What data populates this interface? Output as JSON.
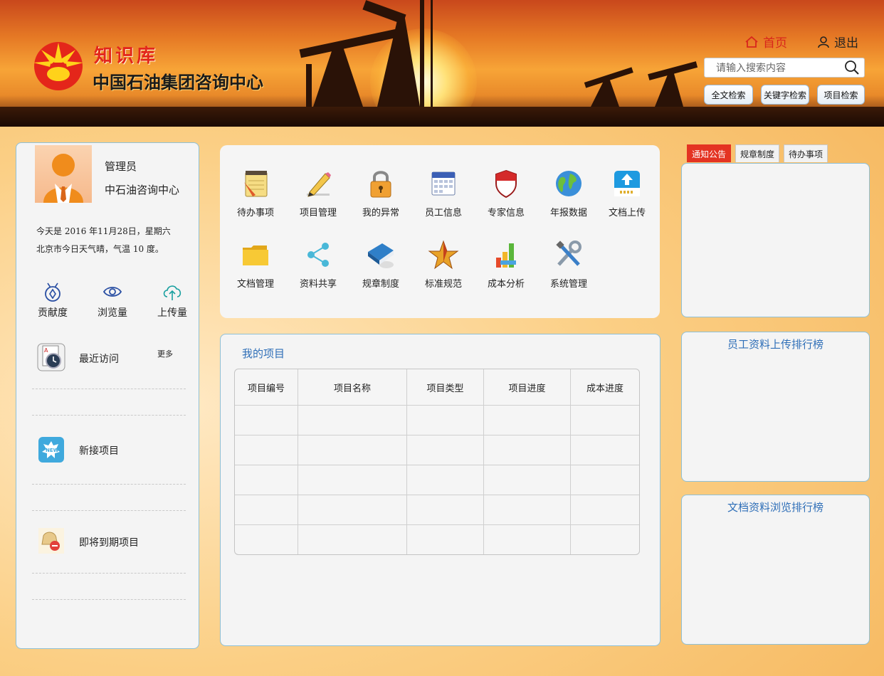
{
  "header": {
    "brand_title": "知识库",
    "brand_subtitle": "中国石油集团咨询中心",
    "nav": {
      "home": "首页",
      "logout": "退出"
    },
    "search": {
      "placeholder": "请输入搜索内容"
    },
    "search_buttons": [
      "全文检索",
      "关键字检索",
      "项目检索"
    ]
  },
  "user": {
    "role": "管理员",
    "org": "中石油咨询中心",
    "date_line": "今天是 2016 年11月28日，星期六",
    "weather_line": "北京市今日天气晴，气温 10 度。"
  },
  "stats": [
    {
      "label": "贡献度",
      "icon": "medal-icon"
    },
    {
      "label": "浏览量",
      "icon": "eye-icon"
    },
    {
      "label": "上传量",
      "icon": "cloud-upload-icon"
    }
  ],
  "sections": {
    "recent": "最近访问",
    "more": "更多",
    "new_projects": "新接项目",
    "expiring": "即将到期项目"
  },
  "functions": [
    {
      "label": "待办事项",
      "icon": "notepad-icon"
    },
    {
      "label": "项目管理",
      "icon": "pencil-icon"
    },
    {
      "label": "我的异常",
      "icon": "lock-icon"
    },
    {
      "label": "员工信息",
      "icon": "calendar-icon"
    },
    {
      "label": "专家信息",
      "icon": "shield-icon"
    },
    {
      "label": "年报数据",
      "icon": "globe-icon"
    },
    {
      "label": "文档上传",
      "icon": "upload-icon"
    },
    {
      "label": "文档管理",
      "icon": "folder-icon"
    },
    {
      "label": "资料共享",
      "icon": "share-icon"
    },
    {
      "label": "规章制度",
      "icon": "book-icon"
    },
    {
      "label": "标准规范",
      "icon": "star-icon"
    },
    {
      "label": "成本分析",
      "icon": "bar-chart-icon"
    },
    {
      "label": "系统管理",
      "icon": "tools-icon"
    }
  ],
  "projects": {
    "title": "我的项目",
    "columns": [
      "项目编号",
      "项目名称",
      "项目类型",
      "项目进度",
      "成本进度"
    ],
    "rows": [
      [
        "",
        "",
        "",
        "",
        ""
      ],
      [
        "",
        "",
        "",
        "",
        ""
      ],
      [
        "",
        "",
        "",
        "",
        ""
      ],
      [
        "",
        "",
        "",
        "",
        ""
      ],
      [
        "",
        "",
        "",
        "",
        ""
      ]
    ]
  },
  "tabs": [
    {
      "label": "通知公告",
      "active": true
    },
    {
      "label": "规章制度",
      "active": false
    },
    {
      "label": "待办事项",
      "active": false
    }
  ],
  "rankings": {
    "upload": "员工资料上传排行榜",
    "browse": "文档资料浏览排行榜"
  },
  "colors": {
    "accent_red": "#e43322",
    "title_blue": "#2f6fb8",
    "panel_border": "#8fc0d6"
  }
}
